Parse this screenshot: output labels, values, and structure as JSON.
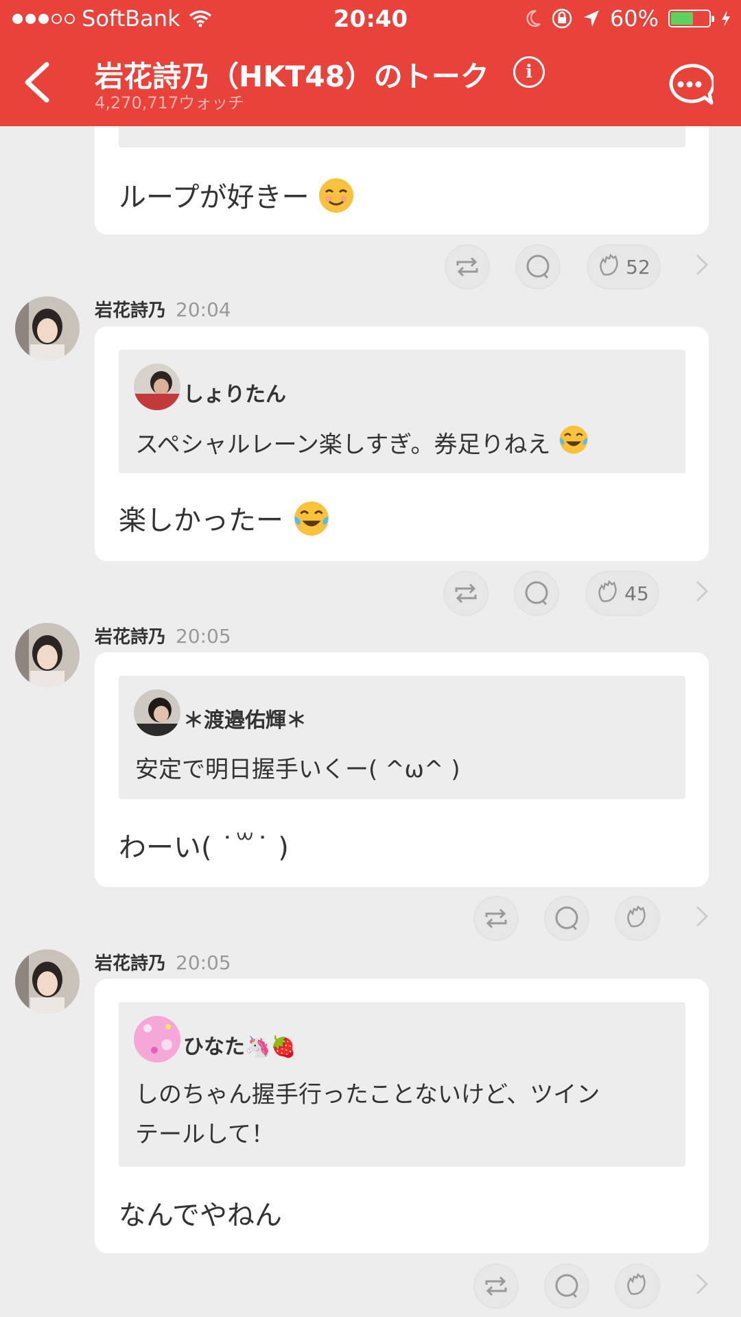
{
  "status_bar": {
    "carrier": "SoftBank",
    "time": "20:40",
    "battery": "60%",
    "battery_level": 0.6
  },
  "header": {
    "title": "岩花詩乃（HKT48）のトーク",
    "watch_count": "4,270,717ウォッチ",
    "bg_color": "#e8423a"
  },
  "icons": [
    "back-icon",
    "info-icon",
    "chat-bubble-icon",
    "retweet-icon",
    "comment-icon",
    "clap-icon",
    "chevron-right-icon",
    "wifi-icon",
    "moon-icon",
    "lock-rotation-icon",
    "location-icon",
    "battery-icon"
  ],
  "posts": [
    {
      "message": "ループが好きー",
      "message_emoji": "smiling-face-emoji",
      "clap_count": "52"
    },
    {
      "author": "岩花詩乃",
      "time": "20:04",
      "quote_user": "しょりたん",
      "quote_text": "スペシャルレーン楽しすぎ。券足りねえ",
      "quote_emoji": "tears-of-joy-emoji",
      "message": "楽しかったー",
      "message_emoji": "tears-of-joy-emoji",
      "clap_count": "45"
    },
    {
      "author": "岩花詩乃",
      "time": "20:05",
      "quote_user": "＊渡邉佑輝＊",
      "quote_text": "安定で明日握手いくー( ^ω^ )",
      "message": "わーい( ˙꒳˙ )",
      "clap_count": ""
    },
    {
      "author": "岩花詩乃",
      "time": "20:05",
      "quote_user": "ひなた🦄🍓",
      "quote_text_line1": "しのちゃん握手行ったことないけど、ツイン",
      "quote_text_line2": "テールして！",
      "message": "なんでやねん",
      "clap_count": ""
    }
  ]
}
